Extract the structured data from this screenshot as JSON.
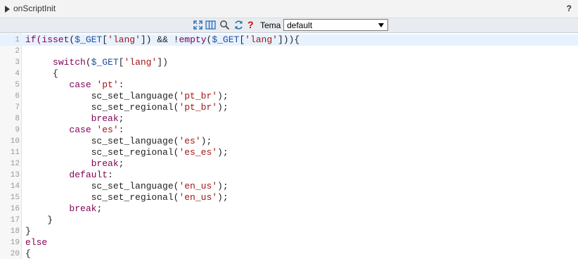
{
  "header": {
    "title": "onScriptInit",
    "help": "?"
  },
  "toolbar": {
    "icons": [
      "fullscreen-icon",
      "columns-icon",
      "search-icon",
      "refresh-icon",
      "help-icon"
    ],
    "help_glyph": "?",
    "tema_label": "Tema",
    "tema_value": "default"
  },
  "colors": {
    "keyword": "#7f0055",
    "string": "#a31515",
    "variable": "#1f4e9e",
    "help_red": "#d40000",
    "active_line": "#e8f2ff"
  },
  "editor": {
    "active_line": 1,
    "lines": [
      {
        "n": "1",
        "tokens": [
          [
            "kw",
            "if("
          ],
          [
            "kw",
            "isset"
          ],
          [
            "plain",
            "("
          ],
          [
            "var",
            "$_GET"
          ],
          [
            "plain",
            "["
          ],
          [
            "str",
            "'lang'"
          ],
          [
            "plain",
            "]) && !"
          ],
          [
            "kw",
            "empty"
          ],
          [
            "plain",
            "("
          ],
          [
            "var",
            "$_GET"
          ],
          [
            "plain",
            "["
          ],
          [
            "str",
            "'lang'"
          ],
          [
            "plain",
            "])){"
          ]
        ]
      },
      {
        "n": "2",
        "tokens": []
      },
      {
        "n": "3",
        "tokens": [
          [
            "plain",
            "     "
          ],
          [
            "kw",
            "switch"
          ],
          [
            "plain",
            "("
          ],
          [
            "var",
            "$_GET"
          ],
          [
            "plain",
            "["
          ],
          [
            "str",
            "'lang'"
          ],
          [
            "plain",
            "])"
          ]
        ]
      },
      {
        "n": "4",
        "tokens": [
          [
            "plain",
            "     {"
          ]
        ]
      },
      {
        "n": "5",
        "tokens": [
          [
            "plain",
            "        "
          ],
          [
            "kw",
            "case"
          ],
          [
            "plain",
            " "
          ],
          [
            "str",
            "'pt'"
          ],
          [
            "plain",
            ":"
          ]
        ]
      },
      {
        "n": "6",
        "tokens": [
          [
            "plain",
            "            sc_set_language("
          ],
          [
            "str",
            "'pt_br'"
          ],
          [
            "plain",
            ");"
          ]
        ]
      },
      {
        "n": "7",
        "tokens": [
          [
            "plain",
            "            sc_set_regional("
          ],
          [
            "str",
            "'pt_br'"
          ],
          [
            "plain",
            ");"
          ]
        ]
      },
      {
        "n": "8",
        "tokens": [
          [
            "plain",
            "            "
          ],
          [
            "kw",
            "break"
          ],
          [
            "plain",
            ";"
          ]
        ]
      },
      {
        "n": "9",
        "tokens": [
          [
            "plain",
            "        "
          ],
          [
            "kw",
            "case"
          ],
          [
            "plain",
            " "
          ],
          [
            "str",
            "'es'"
          ],
          [
            "plain",
            ":"
          ]
        ]
      },
      {
        "n": "10",
        "tokens": [
          [
            "plain",
            "            sc_set_language("
          ],
          [
            "str",
            "'es'"
          ],
          [
            "plain",
            ");"
          ]
        ]
      },
      {
        "n": "11",
        "tokens": [
          [
            "plain",
            "            sc_set_regional("
          ],
          [
            "str",
            "'es_es'"
          ],
          [
            "plain",
            ");"
          ]
        ]
      },
      {
        "n": "12",
        "tokens": [
          [
            "plain",
            "            "
          ],
          [
            "kw",
            "break"
          ],
          [
            "plain",
            ";"
          ]
        ]
      },
      {
        "n": "13",
        "tokens": [
          [
            "plain",
            "        "
          ],
          [
            "kw",
            "default"
          ],
          [
            "plain",
            ":"
          ]
        ]
      },
      {
        "n": "14",
        "tokens": [
          [
            "plain",
            "            sc_set_language("
          ],
          [
            "str",
            "'en_us'"
          ],
          [
            "plain",
            ");"
          ]
        ]
      },
      {
        "n": "15",
        "tokens": [
          [
            "plain",
            "            sc_set_regional("
          ],
          [
            "str",
            "'en_us'"
          ],
          [
            "plain",
            ");"
          ]
        ]
      },
      {
        "n": "16",
        "tokens": [
          [
            "plain",
            "        "
          ],
          [
            "kw",
            "break"
          ],
          [
            "plain",
            ";"
          ]
        ]
      },
      {
        "n": "17",
        "tokens": [
          [
            "plain",
            "    }"
          ]
        ]
      },
      {
        "n": "18",
        "tokens": [
          [
            "plain",
            "}"
          ]
        ]
      },
      {
        "n": "19",
        "tokens": [
          [
            "kw",
            "else"
          ]
        ]
      },
      {
        "n": "20",
        "tokens": [
          [
            "plain",
            "{"
          ]
        ]
      }
    ]
  }
}
